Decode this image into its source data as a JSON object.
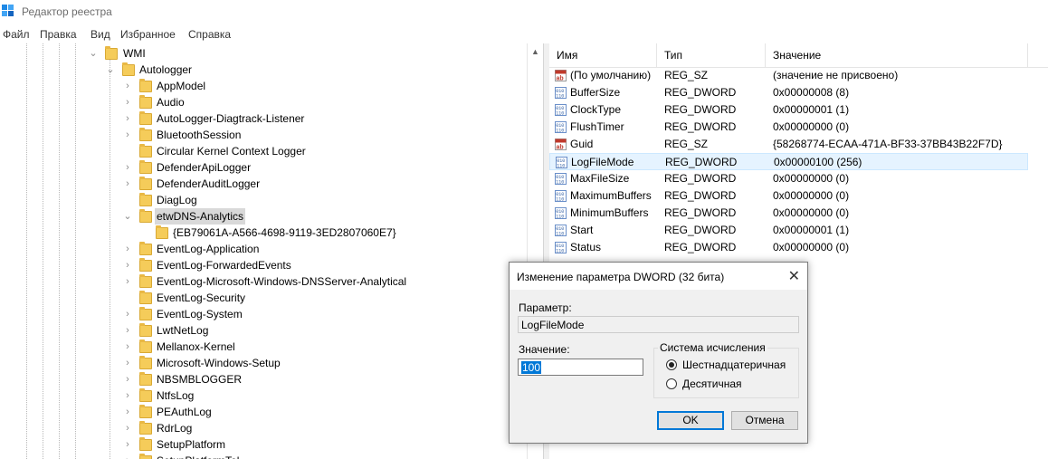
{
  "window": {
    "title": "Редактор реестра"
  },
  "menu": [
    "Файл",
    "Правка",
    "Вид",
    "Избранное",
    "Справка"
  ],
  "tree": {
    "parent": "WMI",
    "current": "Autologger",
    "children": [
      {
        "label": "AppModel",
        "expandable": true
      },
      {
        "label": "Audio",
        "expandable": true
      },
      {
        "label": "AutoLogger-Diagtrack-Listener",
        "expandable": true
      },
      {
        "label": "BluetoothSession",
        "expandable": true
      },
      {
        "label": "Circular Kernel Context Logger",
        "expandable": false
      },
      {
        "label": "DefenderApiLogger",
        "expandable": true
      },
      {
        "label": "DefenderAuditLogger",
        "expandable": true
      },
      {
        "label": "DiagLog",
        "expandable": false
      },
      {
        "label": "etwDNS-Analytics",
        "expanded": true,
        "selected": true
      },
      {
        "label": "{EB79061A-A566-4698-9119-3ED2807060E7}",
        "child": true
      },
      {
        "label": "EventLog-Application",
        "expandable": true
      },
      {
        "label": "EventLog-ForwardedEvents",
        "expandable": true
      },
      {
        "label": "EventLog-Microsoft-Windows-DNSServer-Analytical",
        "expandable": true
      },
      {
        "label": "EventLog-Security",
        "expandable": false
      },
      {
        "label": "EventLog-System",
        "expandable": true
      },
      {
        "label": "LwtNetLog",
        "expandable": true
      },
      {
        "label": "Mellanox-Kernel",
        "expandable": true
      },
      {
        "label": "Microsoft-Windows-Setup",
        "expandable": true
      },
      {
        "label": "NBSMBLOGGER",
        "expandable": true
      },
      {
        "label": "NtfsLog",
        "expandable": true
      },
      {
        "label": "PEAuthLog",
        "expandable": true
      },
      {
        "label": "RdrLog",
        "expandable": true
      },
      {
        "label": "SetupPlatform",
        "expandable": true
      },
      {
        "label": "SetupPlatformTel",
        "expandable": true
      }
    ]
  },
  "list": {
    "columns": [
      "Имя",
      "Тип",
      "Значение"
    ],
    "rows": [
      {
        "name": "(По умолчанию)",
        "type": "REG_SZ",
        "value": "(значение не присвоено)",
        "icon": "string-value-icon"
      },
      {
        "name": "BufferSize",
        "type": "REG_DWORD",
        "value": "0x00000008 (8)",
        "icon": "binary-value-icon"
      },
      {
        "name": "ClockType",
        "type": "REG_DWORD",
        "value": "0x00000001 (1)",
        "icon": "binary-value-icon"
      },
      {
        "name": "FlushTimer",
        "type": "REG_DWORD",
        "value": "0x00000000 (0)",
        "icon": "binary-value-icon"
      },
      {
        "name": "Guid",
        "type": "REG_SZ",
        "value": "{58268774-ECAA-471A-BF33-37BB43B22F7D}",
        "icon": "string-value-icon"
      },
      {
        "name": "LogFileMode",
        "type": "REG_DWORD",
        "value": "0x00000100 (256)",
        "icon": "binary-value-icon",
        "selected": true
      },
      {
        "name": "MaxFileSize",
        "type": "REG_DWORD",
        "value": "0x00000000 (0)",
        "icon": "binary-value-icon"
      },
      {
        "name": "MaximumBuffers",
        "type": "REG_DWORD",
        "value": "0x00000000 (0)",
        "icon": "binary-value-icon"
      },
      {
        "name": "MinimumBuffers",
        "type": "REG_DWORD",
        "value": "0x00000000 (0)",
        "icon": "binary-value-icon"
      },
      {
        "name": "Start",
        "type": "REG_DWORD",
        "value": "0x00000001 (1)",
        "icon": "binary-value-icon"
      },
      {
        "name": "Status",
        "type": "REG_DWORD",
        "value": "0x00000000 (0)",
        "icon": "binary-value-icon"
      }
    ]
  },
  "dialog": {
    "title": "Изменение параметра DWORD (32 бита)",
    "param_label": "Параметр:",
    "param_value": "LogFileMode",
    "value_label": "Значение:",
    "value": "100",
    "base_group": "Система исчисления",
    "hex_label": "Шестнадцатеричная",
    "dec_label": "Десятичная",
    "hex_selected": true,
    "ok": "OK",
    "cancel": "Отмена"
  },
  "colors": {
    "selection": "#e5f3ff",
    "accent": "#0078d7",
    "folder": "#f5cc5a"
  }
}
